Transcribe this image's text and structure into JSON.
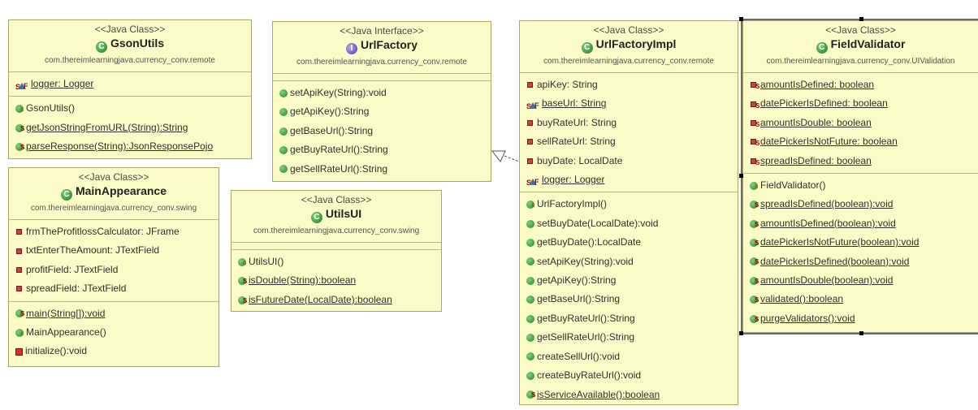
{
  "classes": {
    "gsonutils": {
      "stereotype": "<<Java Class>>",
      "name": "GsonUtils",
      "kind": "class",
      "package": "com.thereimlearningjava.currency_conv.remote",
      "fields": [
        {
          "text": "logger: Logger",
          "icon": "static-final-field",
          "underline": true
        }
      ],
      "methods": [
        {
          "text": "GsonUtils()",
          "icon": "constructor",
          "underline": false
        },
        {
          "text": "getJsonStringFromURL(String):String",
          "icon": "static-public",
          "underline": true
        },
        {
          "text": "parseResponse(String):JsonResponsePojo",
          "icon": "static-public",
          "underline": true
        }
      ]
    },
    "mainappearance": {
      "stereotype": "<<Java Class>>",
      "name": "MainAppearance",
      "kind": "class",
      "package": "com.thereimlearningjava.currency_conv.swing",
      "fields": [
        {
          "text": "frmTheProfitlossCalculator: JFrame",
          "icon": "private",
          "underline": false
        },
        {
          "text": "txtEnterTheAmount: JTextField",
          "icon": "private",
          "underline": false
        },
        {
          "text": "profitField: JTextField",
          "icon": "private",
          "underline": false
        },
        {
          "text": "spreadField: JTextField",
          "icon": "private",
          "underline": false
        }
      ],
      "methods": [
        {
          "text": "main(String[]):void",
          "icon": "static-public",
          "underline": true
        },
        {
          "text": "MainAppearance()",
          "icon": "constructor",
          "underline": false
        },
        {
          "text": "initialize():void",
          "icon": "private-method",
          "underline": false
        }
      ]
    },
    "urlfactory": {
      "stereotype": "<<Java Interface>>",
      "name": "UrlFactory",
      "kind": "interface",
      "package": "com.thereimlearningjava.currency_conv.remote",
      "fields": [],
      "methods": [
        {
          "text": "setApiKey(String):void",
          "icon": "public",
          "underline": false
        },
        {
          "text": "getApiKey():String",
          "icon": "public",
          "underline": false
        },
        {
          "text": "getBaseUrl():String",
          "icon": "public",
          "underline": false
        },
        {
          "text": "getBuyRateUrl():String",
          "icon": "public",
          "underline": false
        },
        {
          "text": "getSellRateUrl():String",
          "icon": "public",
          "underline": false
        }
      ]
    },
    "utilsui": {
      "stereotype": "<<Java Class>>",
      "name": "UtilsUI",
      "kind": "class",
      "package": "com.thereimlearningjava.currency_conv.swing",
      "fields": [],
      "methods": [
        {
          "text": "UtilsUI()",
          "icon": "constructor",
          "underline": false
        },
        {
          "text": "isDouble(String):boolean",
          "icon": "static-public",
          "underline": true
        },
        {
          "text": "isFutureDate(LocalDate):boolean",
          "icon": "static-public",
          "underline": true
        }
      ]
    },
    "urlfactoryimpl": {
      "stereotype": "<<Java Class>>",
      "name": "UrlFactoryImpl",
      "kind": "class",
      "package": "com.thereimlearningjava.currency_conv.remote",
      "fields": [
        {
          "text": "apiKey: String",
          "icon": "private",
          "underline": false
        },
        {
          "text": "baseUrl: String",
          "icon": "static-final-field",
          "underline": true
        },
        {
          "text": "buyRateUrl: String",
          "icon": "private",
          "underline": false
        },
        {
          "text": "sellRateUrl: String",
          "icon": "private",
          "underline": false
        },
        {
          "text": "buyDate: LocalDate",
          "icon": "private",
          "underline": false
        },
        {
          "text": "logger: Logger",
          "icon": "static-final-field",
          "underline": true
        }
      ],
      "methods": [
        {
          "text": "UrlFactoryImpl()",
          "icon": "constructor",
          "underline": false
        },
        {
          "text": "setBuyDate(LocalDate):void",
          "icon": "public",
          "underline": false
        },
        {
          "text": "getBuyDate():LocalDate",
          "icon": "public",
          "underline": false
        },
        {
          "text": "setApiKey(String):void",
          "icon": "public",
          "underline": false
        },
        {
          "text": "getApiKey():String",
          "icon": "public",
          "underline": false
        },
        {
          "text": "getBaseUrl():String",
          "icon": "public",
          "underline": false
        },
        {
          "text": "getBuyRateUrl():String",
          "icon": "public",
          "underline": false
        },
        {
          "text": "getSellRateUrl():String",
          "icon": "public",
          "underline": false
        },
        {
          "text": "createSellUrl():void",
          "icon": "public",
          "underline": false
        },
        {
          "text": "createBuyRateUrl():void",
          "icon": "public",
          "underline": false
        },
        {
          "text": "isServiceAvailable():boolean",
          "icon": "static-public",
          "underline": true
        }
      ]
    },
    "fieldvalidator": {
      "stereotype": "<<Java Class>>",
      "name": "FieldValidator",
      "kind": "class",
      "package": "com.thereimlearningjava.currency_conv.UIValidation",
      "fields": [
        {
          "text": "amountIsDefined: boolean",
          "icon": "static-private",
          "underline": true
        },
        {
          "text": "datePickerIsDefined: boolean",
          "icon": "static-private",
          "underline": true
        },
        {
          "text": "amountIsDouble: boolean",
          "icon": "static-private",
          "underline": true
        },
        {
          "text": "datePickerIsNotFuture: boolean",
          "icon": "static-private",
          "underline": true
        },
        {
          "text": "spreadIsDefined: boolean",
          "icon": "static-private",
          "underline": true
        }
      ],
      "methods": [
        {
          "text": "FieldValidator()",
          "icon": "constructor",
          "underline": false
        },
        {
          "text": "spreadIsDefined(boolean):void",
          "icon": "static-public",
          "underline": true
        },
        {
          "text": "amountIsDefined(boolean):void",
          "icon": "static-public",
          "underline": true
        },
        {
          "text": "datePickerIsNotFuture(boolean):void",
          "icon": "static-public",
          "underline": true
        },
        {
          "text": "datePickerIsDefined(boolean):void",
          "icon": "static-public",
          "underline": true
        },
        {
          "text": "amountIsDouble(boolean):void",
          "icon": "static-public",
          "underline": true
        },
        {
          "text": "validated():boolean",
          "icon": "static-public",
          "underline": true
        },
        {
          "text": "purgeValidators():void",
          "icon": "static-public",
          "underline": true
        }
      ]
    }
  },
  "relations": [
    {
      "type": "realization",
      "from": "UrlFactoryImpl",
      "to": "UrlFactory"
    }
  ],
  "selected": "FieldValidator"
}
